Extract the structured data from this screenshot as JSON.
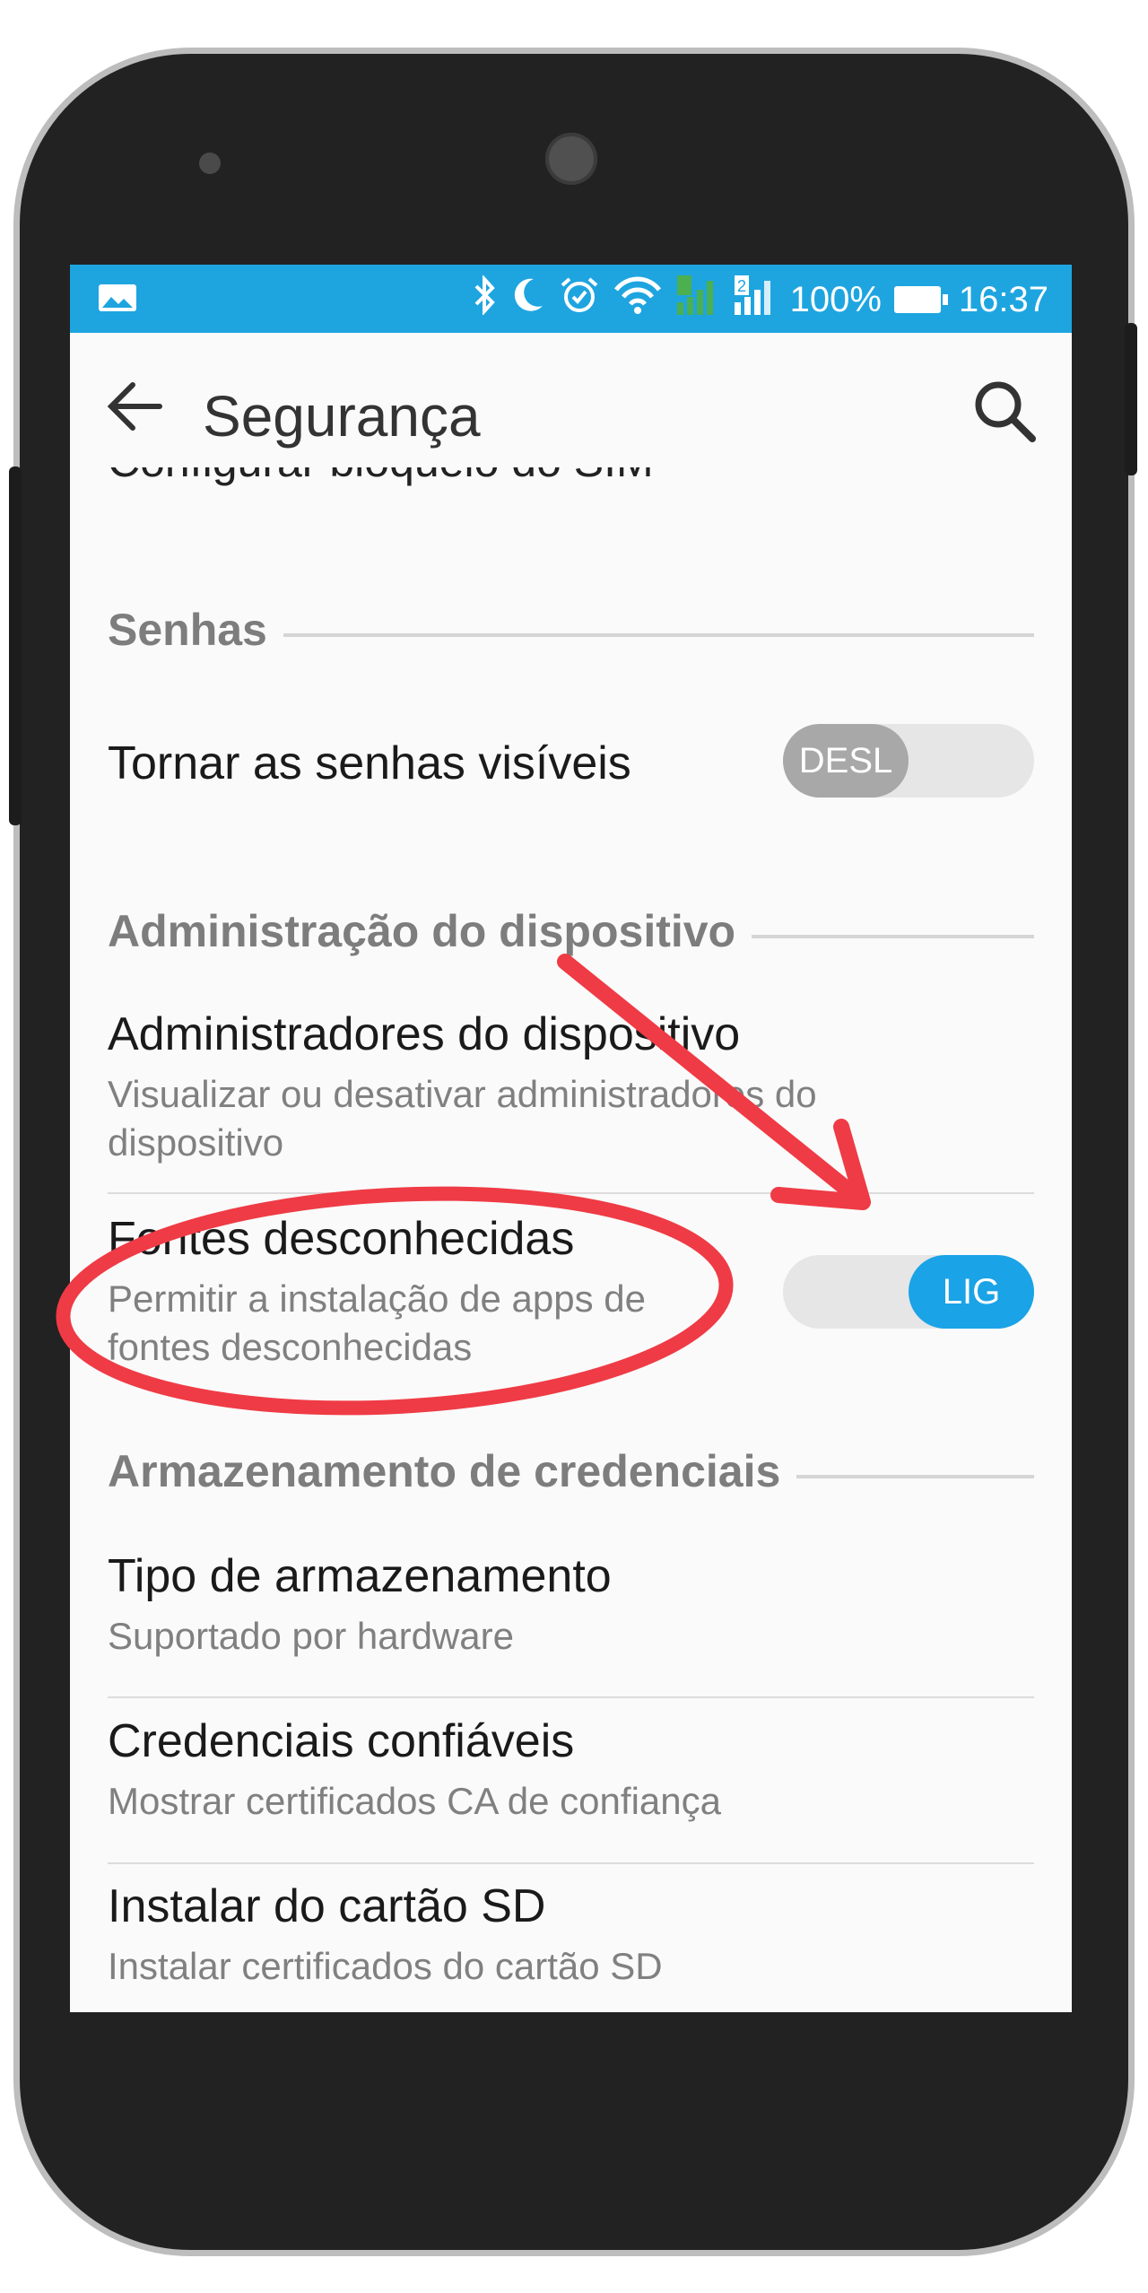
{
  "status_bar": {
    "battery": "100%",
    "time": "16:37",
    "icons": [
      "image-notification-icon",
      "bluetooth-icon",
      "moon-icon",
      "alarm-icon",
      "wifi-icon",
      "signal-sim1-icon",
      "signal-sim2-icon",
      "battery-icon"
    ],
    "background": "#1ea5e0"
  },
  "app_bar": {
    "title": "Segurança",
    "back_icon": "arrow-left-icon",
    "search_icon": "search-icon"
  },
  "list": {
    "cut_item": "Configurar bloqueio do SIM",
    "sections": [
      {
        "label": "Senhas",
        "items": [
          {
            "title": "Tornar as senhas visíveis",
            "switch": "DESL"
          }
        ]
      },
      {
        "label": "Administração do dispositivo",
        "items": [
          {
            "title": "Administradores do dispositivo",
            "subtitle": "Visualizar ou desativar administradores do dispositivo"
          },
          {
            "title": "Fontes desconhecidas",
            "subtitle": "Permitir a instalação de apps de fontes desconhecidas",
            "switch": "LIG"
          }
        ]
      },
      {
        "label": "Armazenamento de credenciais",
        "items": [
          {
            "title": "Tipo de armazenamento",
            "subtitle": "Suportado por hardware"
          },
          {
            "title": "Credenciais confiáveis",
            "subtitle": "Mostrar certificados CA de confiança"
          },
          {
            "title": "Instalar do cartão SD",
            "subtitle": "Instalar certificados do cartão SD"
          }
        ]
      }
    ]
  },
  "colors": {
    "accent": "#1aa3e6",
    "annotation": "#ef3b45"
  }
}
